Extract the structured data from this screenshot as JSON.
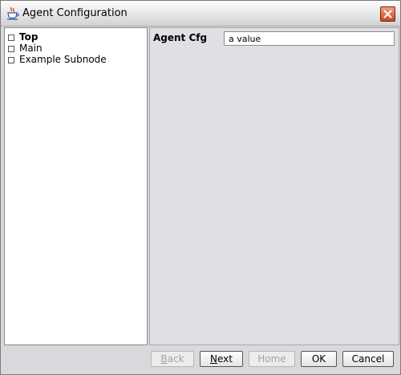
{
  "window": {
    "title": "Agent Configuration"
  },
  "tree": {
    "items": [
      {
        "label": "Top",
        "selected": true
      },
      {
        "label": "Main",
        "selected": false
      },
      {
        "label": "Example Subnode",
        "selected": false
      }
    ]
  },
  "form": {
    "field_label": "Agent Cfg",
    "field_value": "a value"
  },
  "buttons": {
    "back": {
      "label": "Back",
      "mnemonic": "B",
      "rest": "ack",
      "enabled": false
    },
    "next": {
      "label": "Next",
      "mnemonic": "N",
      "rest": "ext",
      "enabled": true
    },
    "home": {
      "label": "Home",
      "enabled": false
    },
    "ok": {
      "label": "OK",
      "enabled": true
    },
    "cancel": {
      "label": "Cancel",
      "enabled": true
    }
  },
  "icons": {
    "app": "java-coffee-cup-icon",
    "close": "close-icon"
  },
  "colors": {
    "window_bg": "#d9d9dd",
    "content_bg": "#e0dfe3",
    "close_button": "#c9461f"
  }
}
